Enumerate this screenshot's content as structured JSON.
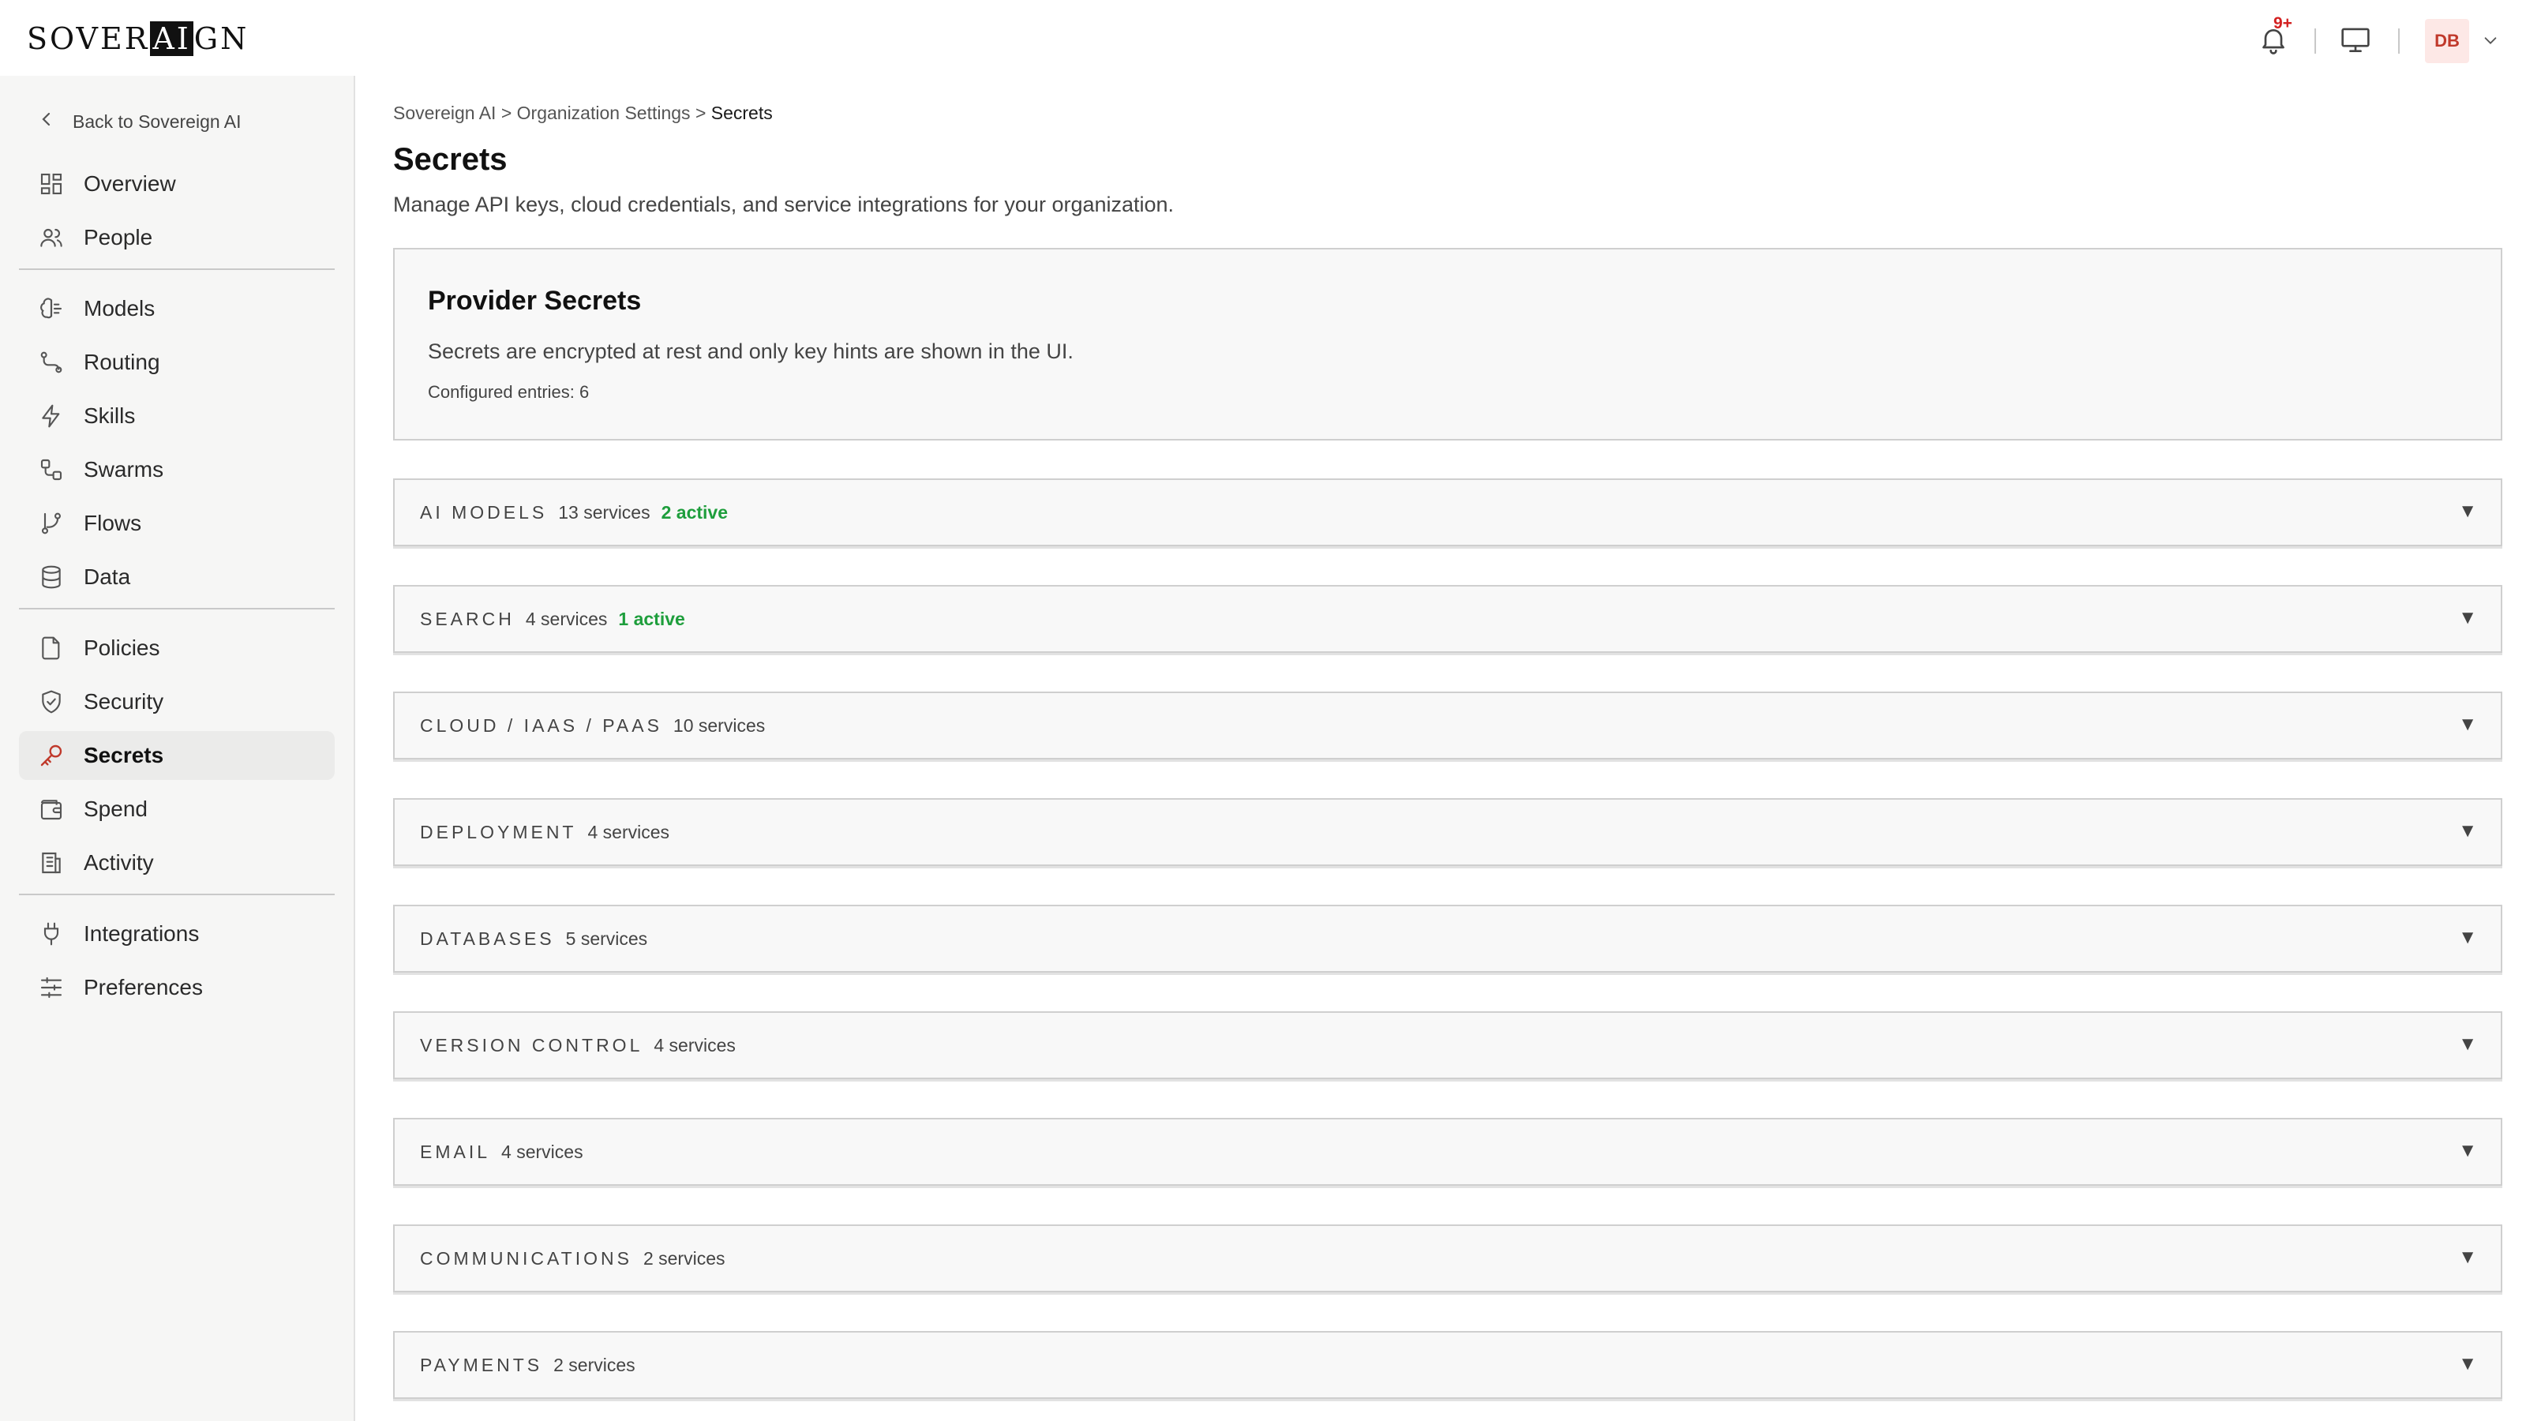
{
  "app": {
    "logo_pre": "SOVER",
    "logo_ai": "AI",
    "logo_post": "GN",
    "notification_badge": "9+",
    "user_initials": "DB"
  },
  "sidebar": {
    "back_label": "Back to Sovereign AI",
    "groups": [
      [
        {
          "label": "Overview",
          "icon": "grid-icon"
        },
        {
          "label": "People",
          "icon": "people-icon"
        }
      ],
      [
        {
          "label": "Models",
          "icon": "brain-icon"
        },
        {
          "label": "Routing",
          "icon": "route-icon"
        },
        {
          "label": "Skills",
          "icon": "lightning-icon"
        },
        {
          "label": "Swarms",
          "icon": "nodes-icon"
        },
        {
          "label": "Flows",
          "icon": "branch-icon"
        },
        {
          "label": "Data",
          "icon": "database-icon"
        }
      ],
      [
        {
          "label": "Policies",
          "icon": "document-icon"
        },
        {
          "label": "Security",
          "icon": "shield-icon"
        },
        {
          "label": "Secrets",
          "icon": "key-icon",
          "active": true
        },
        {
          "label": "Spend",
          "icon": "wallet-icon"
        },
        {
          "label": "Activity",
          "icon": "log-icon"
        }
      ],
      [
        {
          "label": "Integrations",
          "icon": "plug-icon"
        },
        {
          "label": "Preferences",
          "icon": "sliders-icon"
        }
      ]
    ]
  },
  "breadcrumb": {
    "items": [
      "Sovereign AI",
      "Organization Settings"
    ],
    "separator": ">",
    "current": "Secrets"
  },
  "page": {
    "title": "Secrets",
    "subtitle": "Manage API keys, cloud credentials, and service integrations for your organization."
  },
  "provider": {
    "title": "Provider Secrets",
    "description": "Secrets are encrypted at rest and only key hints are shown in the UI.",
    "configured": "Configured entries: 6"
  },
  "categories": [
    {
      "name": "AI MODELS",
      "services": "13 services",
      "active": "2 active"
    },
    {
      "name": "SEARCH",
      "services": "4 services",
      "active": "1 active"
    },
    {
      "name": "CLOUD / IAAS / PAAS",
      "services": "10 services"
    },
    {
      "name": "DEPLOYMENT",
      "services": "4 services"
    },
    {
      "name": "DATABASES",
      "services": "5 services"
    },
    {
      "name": "VERSION CONTROL",
      "services": "4 services"
    },
    {
      "name": "EMAIL",
      "services": "4 services"
    },
    {
      "name": "COMMUNICATIONS",
      "services": "2 services"
    },
    {
      "name": "PAYMENTS",
      "services": "2 services"
    }
  ],
  "colors": {
    "accent_active": "#1e9e3c",
    "active_nav_icon": "#c0392b",
    "badge": "#d32020"
  }
}
